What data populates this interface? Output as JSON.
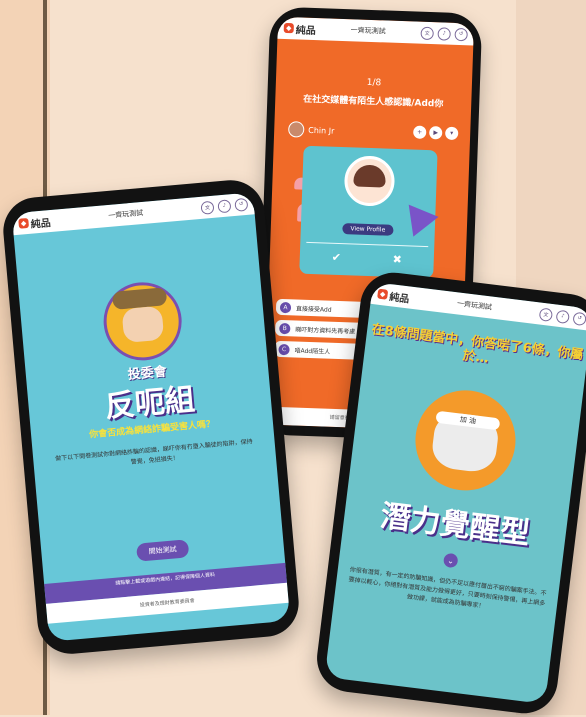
{
  "phone1": {
    "logo": "純品",
    "title": "一齊玩測試",
    "progress": "1/8",
    "question": "在社交媒體有陌生人感認識/Add你",
    "username": "Chin Jr",
    "view_profile": "View Profile",
    "options": [
      {
        "letter": "A",
        "text": "直接接受Add"
      },
      {
        "letter": "B",
        "text": "睇吓對方資料先再考慮"
      },
      {
        "letter": "C",
        "text": "唔Add陌生人"
      }
    ],
    "footer": "請留意社交媒體帳戶私隱設定"
  },
  "phone2": {
    "logo": "純品",
    "title": "一齊玩測試",
    "subtitle": "投委會",
    "headline": "反呃組",
    "question": "你會否成為網絡詐騙受害人嗎？",
    "body": "做下以下問卷測試你對網絡詐騙的認識，睇吓你有冇墮入騙徒的陷阱，保持警覺，免招損失！",
    "start_button": "開始測試",
    "footer_purple": "請點擊上載或遊戲內連結，記得保障個人資料",
    "footer_white": "投資者及理財教育委員會"
  },
  "phone3": {
    "logo": "純品",
    "title": "一齊玩測試",
    "headline": "在8條問題當中，你答啱了6條，你屬於…",
    "band": "加 油",
    "result": "潛力覺醒型",
    "body": "你很有潛質，有一定的防騙知識，但仍不足以應付層出不窮的騙案手法。不要掉以輕心，你絕對有潛質及能力做得更好，只要時刻保持警惕，再上網多做功課，就能成為防騙專家！"
  }
}
